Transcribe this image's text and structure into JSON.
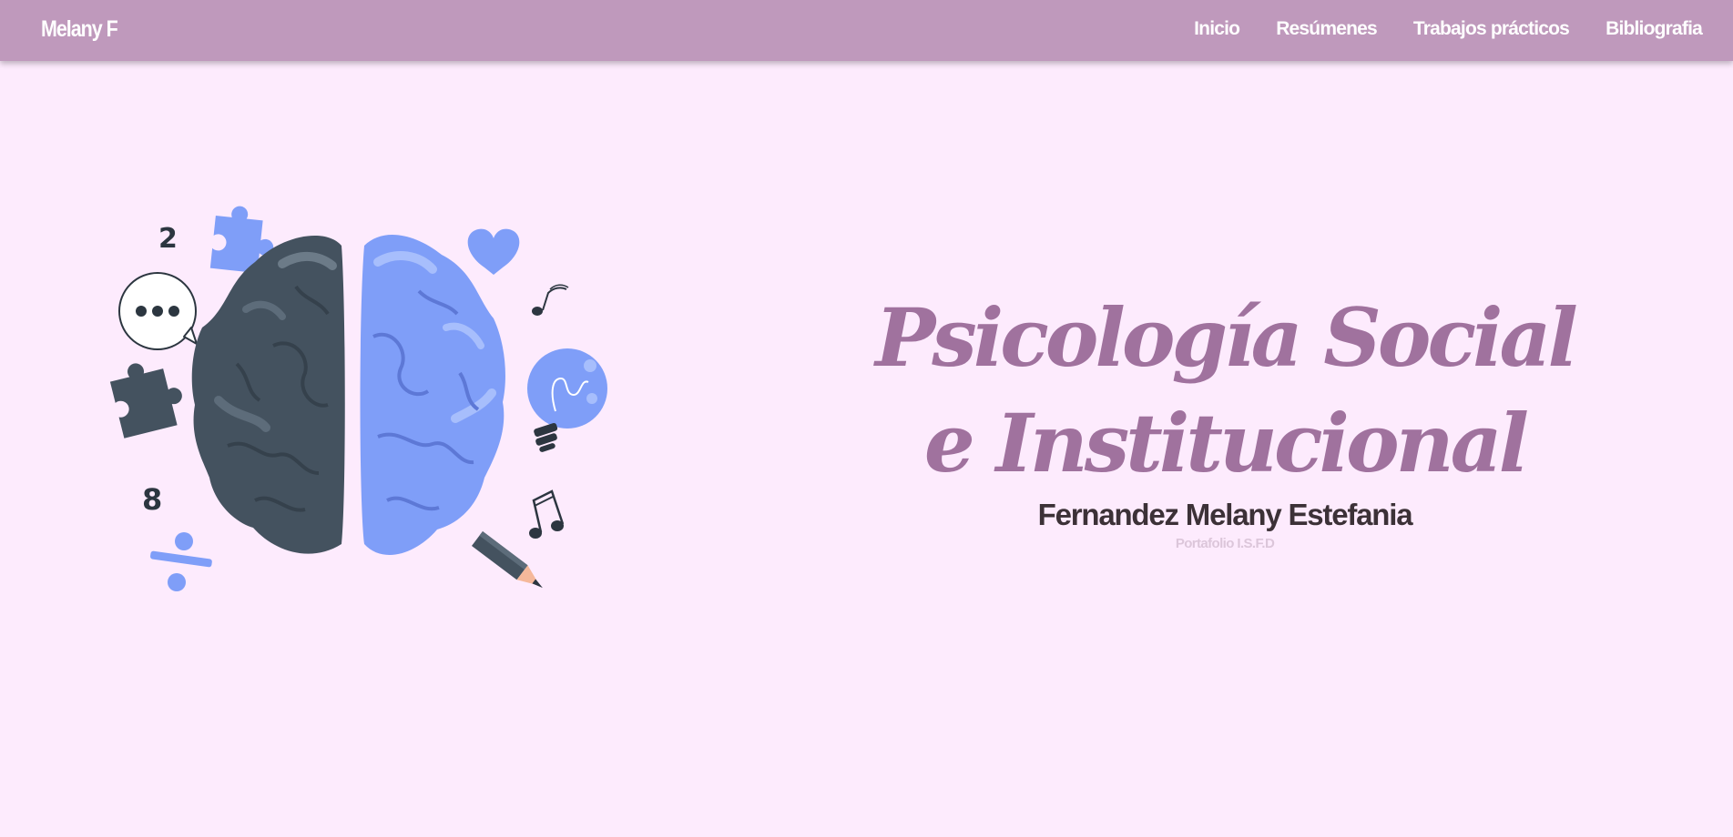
{
  "navbar": {
    "brand": "Melany F",
    "links": [
      {
        "label": "Inicio"
      },
      {
        "label": "Resúmenes"
      },
      {
        "label": "Trabajos prácticos"
      },
      {
        "label": "Bibliografia"
      }
    ]
  },
  "hero": {
    "title": "Psicología Social e Institucional",
    "name": "Fernandez Melany Estefania",
    "subtitle": "Portafolio I.S.F.D",
    "illustration": {
      "icons": [
        "brain-icon",
        "puzzle-piece-icon",
        "speech-bubble-icon",
        "heart-icon",
        "music-note-icon",
        "light-bulb-icon",
        "pencil-icon",
        "division-sign-icon"
      ],
      "numbers": [
        "2",
        "8"
      ]
    }
  },
  "colors": {
    "navbar_bg": "#BF99BC",
    "page_bg": "#FDEBFD",
    "title": "#A0729E",
    "name": "#3C3137",
    "subtitle": "#DCC6DA",
    "brain_dark": "#44525F",
    "brain_blue": "#7F9EF8"
  }
}
